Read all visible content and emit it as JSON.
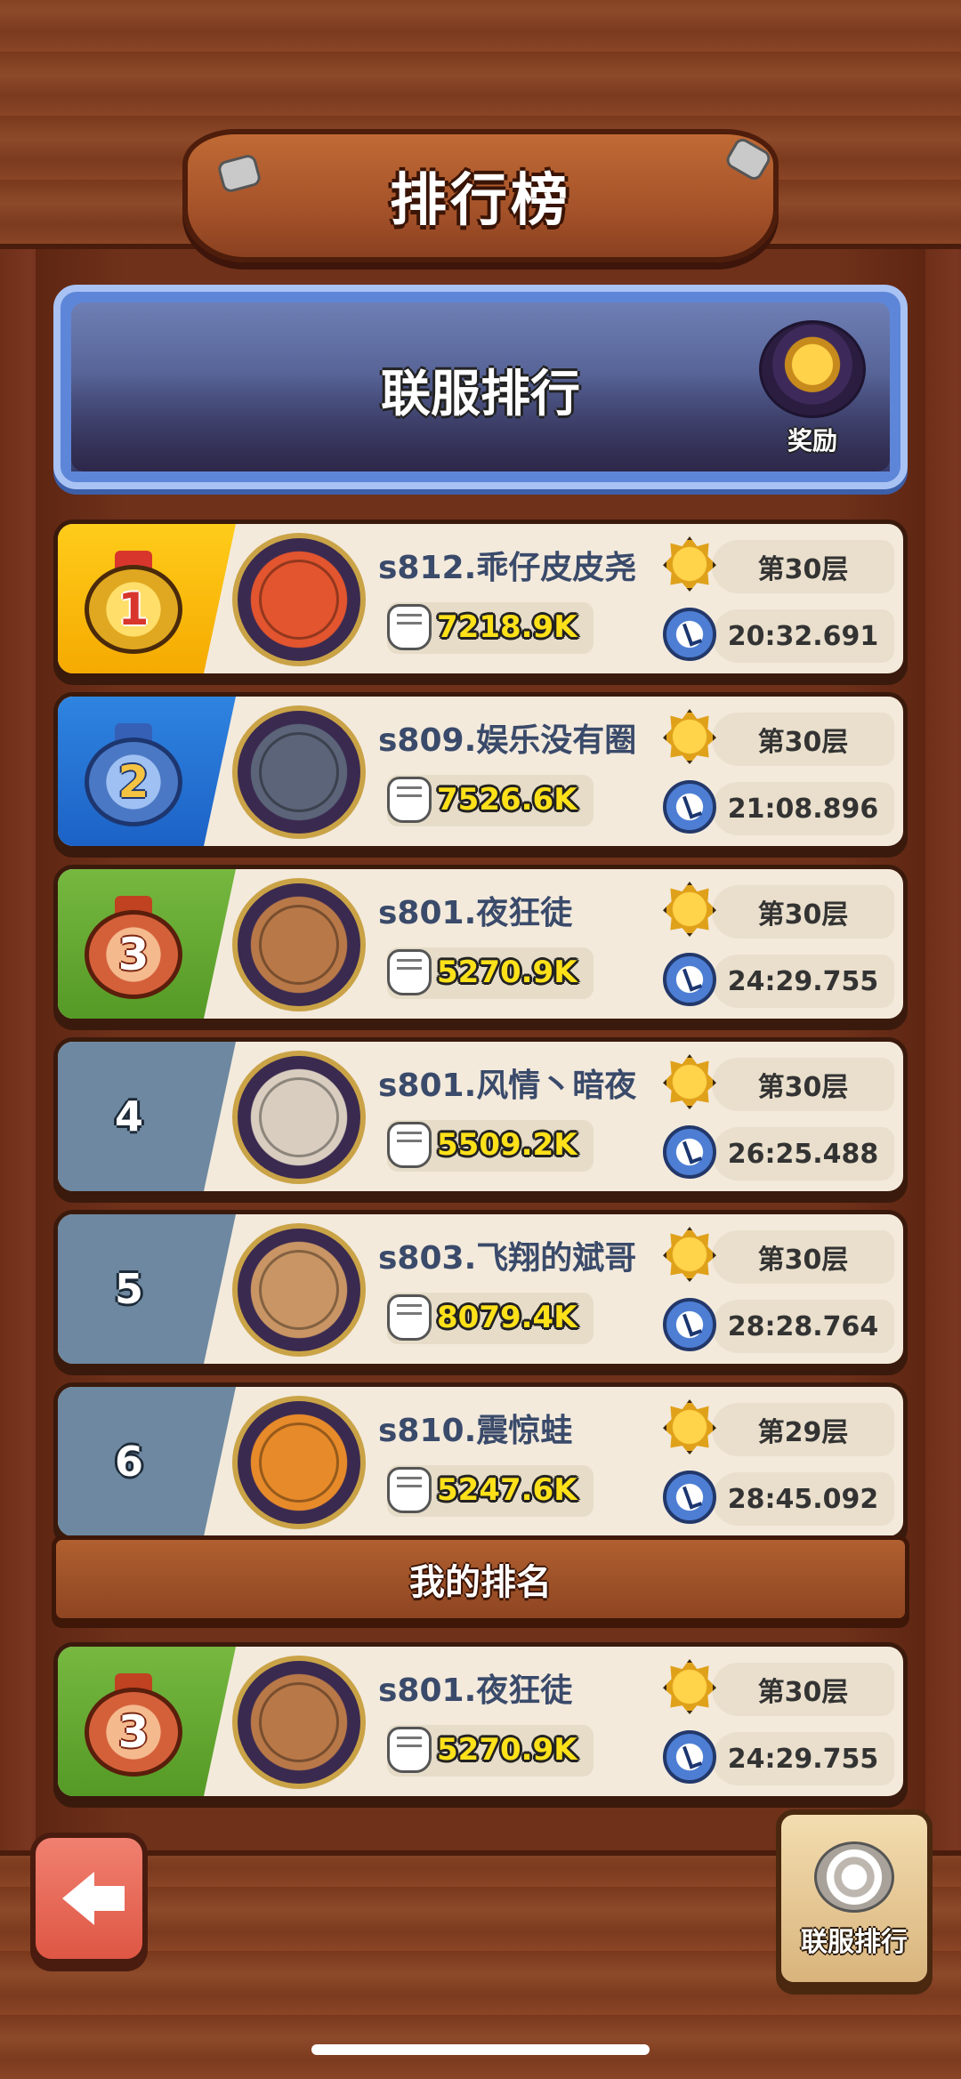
{
  "header": {
    "title": "排行榜"
  },
  "banner": {
    "title": "联服排行",
    "reward_label": "奖励"
  },
  "leaderboard": [
    {
      "rank": "1",
      "name": "s812.乖仔皮皮尧",
      "power": "7218.9K",
      "floor": "第30层",
      "time": "20:32.691",
      "rank_color": "gold",
      "avatar_color": "#e2552e"
    },
    {
      "rank": "2",
      "name": "s809.娱乐没有圈",
      "power": "7526.6K",
      "floor": "第30层",
      "time": "21:08.896",
      "rank_color": "blue",
      "avatar_color": "#5b6478"
    },
    {
      "rank": "3",
      "name": "s801.夜狂徒",
      "power": "5270.9K",
      "floor": "第30层",
      "time": "24:29.755",
      "rank_color": "green",
      "avatar_color": "#b87848"
    },
    {
      "rank": "4",
      "name": "s801.风情丶暗夜",
      "power": "5509.2K",
      "floor": "第30层",
      "time": "26:25.488",
      "rank_color": "slate",
      "avatar_color": "#d8cdbf"
    },
    {
      "rank": "5",
      "name": "s803.飞翔的斌哥",
      "power": "8079.4K",
      "floor": "第30层",
      "time": "28:28.764",
      "rank_color": "slate",
      "avatar_color": "#c99564"
    },
    {
      "rank": "6",
      "name": "s810.震惊蛙",
      "power": "5247.6K",
      "floor": "第29层",
      "time": "28:45.092",
      "rank_color": "slate",
      "avatar_color": "#e78a2a"
    }
  ],
  "my_rank": {
    "label": "我的排名",
    "rank": "3",
    "name": "s801.夜狂徒",
    "power": "5270.9K",
    "floor": "第30层",
    "time": "24:29.755",
    "rank_color": "green",
    "avatar_color": "#b87848"
  },
  "footer": {
    "server_button_label": "联服排行"
  },
  "icons": {
    "back": "arrow-left-icon",
    "power": "fist-icon",
    "floor": "crown-icon",
    "time": "clock-icon",
    "reward": "treasure-chest-icon",
    "server": "swirl-icon"
  }
}
